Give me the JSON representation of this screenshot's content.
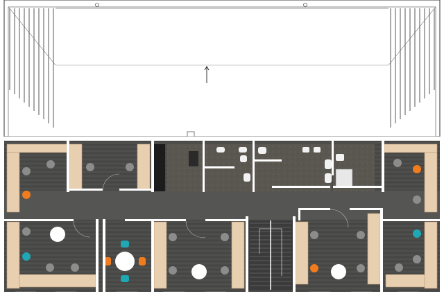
{
  "plan": {
    "type": "architectural floor plan",
    "view": "top-down",
    "roof": {
      "ridge_arrow": "up"
    },
    "colors": {
      "floor": "#4a4a48",
      "corridor": "#555553",
      "wall": "#ffffff",
      "desk": "#e8cfb0",
      "chair": "#8c8c8c",
      "accent_orange": "#f07c1e",
      "accent_teal": "#1fa7b4",
      "round_table": "#ffffff",
      "stair": "#3b3b3b"
    },
    "rooms": [
      {
        "id": "office-nw",
        "desks": 2,
        "chairs": 4
      },
      {
        "id": "office-n2",
        "desks": 2,
        "chairs": 2
      },
      {
        "id": "server-room"
      },
      {
        "id": "restroom-1"
      },
      {
        "id": "restroom-2"
      },
      {
        "id": "kitchenette"
      },
      {
        "id": "office-ne",
        "desks": 2,
        "chairs": 3
      },
      {
        "id": "office-sw",
        "desks": 2,
        "chairs": 6
      },
      {
        "id": "meeting-room-1",
        "chairs": 4
      },
      {
        "id": "office-s2",
        "desks": 2,
        "chairs": 4
      },
      {
        "id": "stairwell"
      },
      {
        "id": "office-s3",
        "desks": 2,
        "chairs": 4
      },
      {
        "id": "office-se",
        "desks": 2,
        "chairs": 3
      }
    ]
  }
}
